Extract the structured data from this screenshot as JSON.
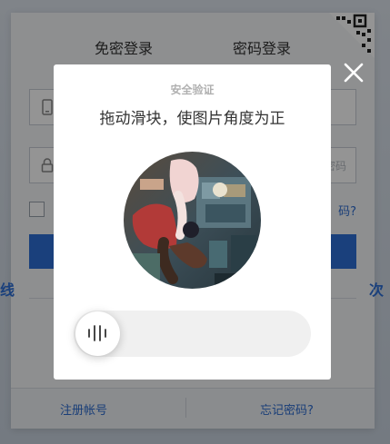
{
  "login": {
    "tab_sms": "免密登录",
    "tab_password": "密码登录",
    "password_hint": "密码",
    "forgot_inline": "码?",
    "side_left_text": "线",
    "side_right_text": "次",
    "footer_register": "注册帐号",
    "footer_forgot": "忘记密码?"
  },
  "captcha": {
    "title": "安全验证",
    "instruction": "拖动滑块，使图片角度为正",
    "slider_progress": 0
  },
  "icons": {
    "close": "close-icon",
    "slider": "slider-grip-icon",
    "qr": "qr-code-icon",
    "phone": "phone-icon",
    "lock": "lock-icon"
  },
  "colors": {
    "accent": "#2e6fd6",
    "link": "#2d6ccf"
  }
}
